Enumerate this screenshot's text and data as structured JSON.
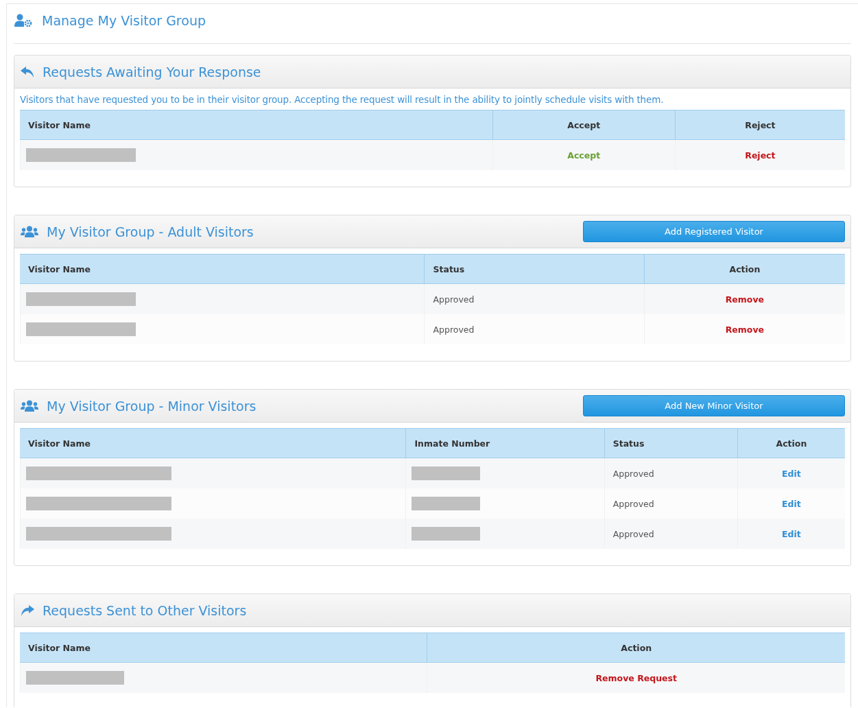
{
  "page": {
    "title": "Manage My Visitor Group"
  },
  "sections": [
    {
      "kind": "incoming",
      "title": "Requests Awaiting Your Response",
      "description": "Visitors that have requested you to be in their visitor group. Accepting the request will result in the ability to jointly schedule visits with them.",
      "columns": [
        {
          "label": "Visitor Name",
          "kind": "data"
        },
        {
          "label": "Accept",
          "kind": "action"
        },
        {
          "label": "Reject",
          "kind": "action"
        }
      ],
      "rows": [
        {
          "cells": [
            {
              "kind": "redacted"
            },
            {
              "kind": "positive",
              "text": "Accept"
            },
            {
              "kind": "negative",
              "text": "Reject"
            }
          ]
        }
      ]
    },
    {
      "kind": "group",
      "title": "My Visitor Group - Adult Visitors",
      "button": "Add Registered Visitor",
      "columns": [
        {
          "label": "Visitor Name",
          "kind": "data"
        },
        {
          "label": "Status",
          "kind": "data"
        },
        {
          "label": "Action",
          "kind": "action"
        }
      ],
      "rows": [
        {
          "cells": [
            {
              "kind": "redacted"
            },
            {
              "kind": "text",
              "text": "Approved"
            },
            {
              "kind": "negative",
              "text": "Remove"
            }
          ]
        },
        {
          "cells": [
            {
              "kind": "redacted"
            },
            {
              "kind": "text",
              "text": "Approved"
            },
            {
              "kind": "negative",
              "text": "Remove"
            }
          ]
        }
      ]
    },
    {
      "kind": "group",
      "title": "My Visitor Group - Minor Visitors",
      "button": "Add New Minor Visitor",
      "columns": [
        {
          "label": "Visitor Name",
          "kind": "data"
        },
        {
          "label": "Inmate Number",
          "kind": "data"
        },
        {
          "label": "Status",
          "kind": "data"
        },
        {
          "label": "Action",
          "kind": "action"
        }
      ],
      "rows": [
        {
          "cells": [
            {
              "kind": "redacted"
            },
            {
              "kind": "redacted"
            },
            {
              "kind": "text",
              "text": "Approved"
            },
            {
              "kind": "primary",
              "text": "Edit"
            }
          ]
        },
        {
          "cells": [
            {
              "kind": "redacted"
            },
            {
              "kind": "redacted"
            },
            {
              "kind": "text",
              "text": "Approved"
            },
            {
              "kind": "primary",
              "text": "Edit"
            }
          ]
        },
        {
          "cells": [
            {
              "kind": "redacted"
            },
            {
              "kind": "redacted"
            },
            {
              "kind": "text",
              "text": "Approved"
            },
            {
              "kind": "primary",
              "text": "Edit"
            }
          ]
        }
      ]
    },
    {
      "kind": "outgoing",
      "title": "Requests Sent to Other Visitors",
      "columns": [
        {
          "label": "Visitor Name",
          "kind": "data"
        },
        {
          "label": "Action",
          "kind": "action"
        }
      ],
      "rows": [
        {
          "cells": [
            {
              "kind": "redacted"
            },
            {
              "kind": "negative",
              "text": "Remove Request"
            }
          ]
        }
      ]
    }
  ]
}
